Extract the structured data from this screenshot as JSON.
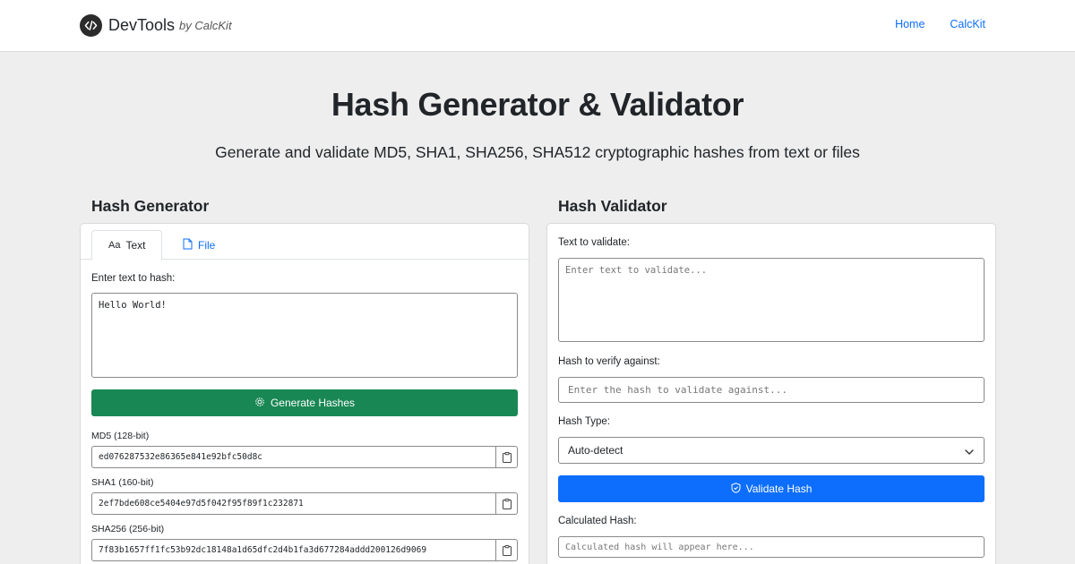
{
  "nav": {
    "brand": "DevTools",
    "brand_by": "by CalcKit",
    "links": [
      "Home",
      "CalcKit"
    ]
  },
  "hero": {
    "title": "Hash Generator & Validator",
    "subtitle": "Generate and validate MD5, SHA1, SHA256, SHA512 cryptographic hashes from text or files"
  },
  "generator": {
    "title": "Hash Generator",
    "tabs": [
      {
        "label": "Text",
        "glyph": "Aa",
        "active": true
      },
      {
        "label": "File",
        "glyph": "file-icon",
        "active": false
      }
    ],
    "input_label": "Enter text to hash:",
    "input_value": "Hello World!",
    "button_label": "Generate Hashes",
    "hashes": [
      {
        "label": "MD5 (128-bit)",
        "value": "ed076287532e86365e841e92bfc50d8c"
      },
      {
        "label": "SHA1 (160-bit)",
        "value": "2ef7bde608ce5404e97d5f042f95f89f1c232871"
      },
      {
        "label": "SHA256 (256-bit)",
        "value": "7f83b1657ff1fc53b92dc18148a1d65dfc2d4b1fa3d677284addd200126d9069"
      }
    ]
  },
  "validator": {
    "title": "Hash Validator",
    "text_label": "Text to validate:",
    "text_placeholder": "Enter text to validate...",
    "hash_label": "Hash to verify against:",
    "hash_placeholder": "Enter the hash to validate against...",
    "type_label": "Hash Type:",
    "type_selected": "Auto-detect",
    "button_label": "Validate Hash",
    "calc_label": "Calculated Hash:",
    "calc_placeholder": "Calculated hash will appear here..."
  },
  "colors": {
    "primary": "#0d6efd",
    "success": "#198754",
    "background": "#eeeeee"
  }
}
